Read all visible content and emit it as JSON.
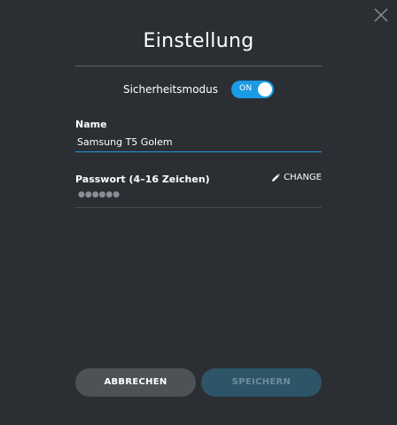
{
  "dialog": {
    "title": "Einstellung",
    "close_icon": "close-icon"
  },
  "security": {
    "label": "Sicherheitsmodus",
    "toggle_state": "ON",
    "toggle_color": "#1a9be6"
  },
  "name_field": {
    "label": "Name",
    "value": "Samsung T5 Golem"
  },
  "password_field": {
    "label": "Passwort (4–16 Zeichen)",
    "masked_value": "●●●●●●",
    "change_label": "CHANGE",
    "change_icon": "pencil-icon"
  },
  "buttons": {
    "cancel_label": "ABBRECHEN",
    "save_label": "SPEICHERN"
  }
}
